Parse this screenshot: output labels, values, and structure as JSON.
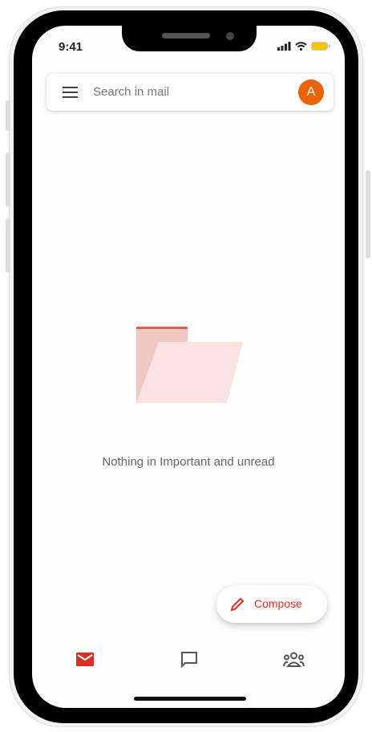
{
  "status_bar": {
    "time": "9:41"
  },
  "search": {
    "placeholder": "Search in mail",
    "avatar_letter": "A"
  },
  "empty_state": {
    "message": "Nothing in Important and unread"
  },
  "compose": {
    "label": "Compose"
  },
  "bottom_nav": {
    "items": [
      {
        "icon": "mail-icon",
        "active": true
      },
      {
        "icon": "chat-icon",
        "active": false
      },
      {
        "icon": "meet-icon",
        "active": false
      }
    ]
  },
  "colors": {
    "accent": "#d93025",
    "avatar": "#e8630a",
    "battery": "#f5c400"
  }
}
